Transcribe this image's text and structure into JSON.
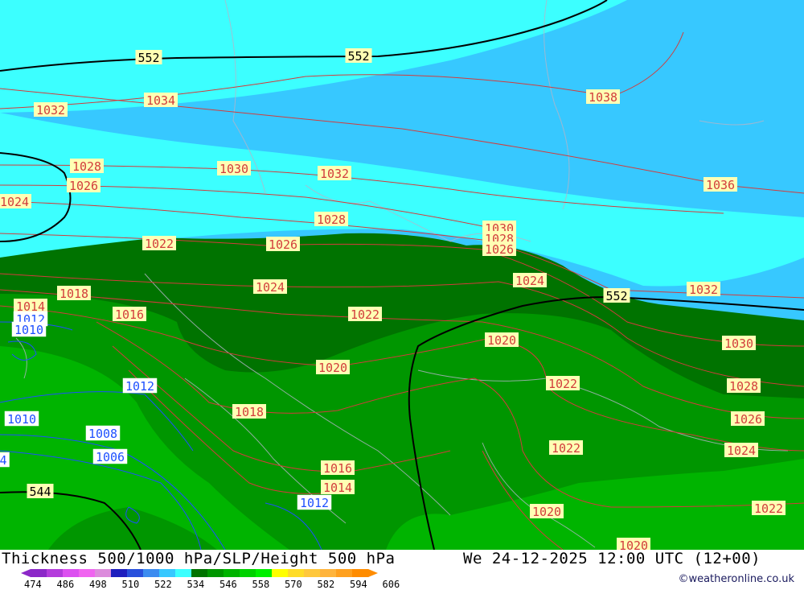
{
  "map": {
    "thickness_labels": [
      {
        "id": "t552a",
        "text": "552"
      },
      {
        "id": "t552b",
        "text": "552"
      },
      {
        "id": "t552c",
        "text": "552"
      },
      {
        "id": "t544",
        "text": "544"
      }
    ],
    "slp_labels": [
      {
        "id": "p1",
        "text": "1032"
      },
      {
        "id": "p2",
        "text": "1034"
      },
      {
        "id": "p3",
        "text": "1038"
      },
      {
        "id": "p4",
        "text": "1028"
      },
      {
        "id": "p5",
        "text": "1030"
      },
      {
        "id": "p6",
        "text": "1032"
      },
      {
        "id": "p7",
        "text": "1026"
      },
      {
        "id": "p8",
        "text": "1036"
      },
      {
        "id": "p9",
        "text": "1024"
      },
      {
        "id": "p10",
        "text": "1028"
      },
      {
        "id": "p11",
        "text": "1030"
      },
      {
        "id": "p12",
        "text": "1028"
      },
      {
        "id": "p13",
        "text": "1026"
      },
      {
        "id": "p14",
        "text": "1022"
      },
      {
        "id": "p15",
        "text": "1026"
      },
      {
        "id": "p16",
        "text": "1024"
      },
      {
        "id": "p17",
        "text": "1024"
      },
      {
        "id": "p18",
        "text": "1032"
      },
      {
        "id": "p19",
        "text": "1018"
      },
      {
        "id": "p20",
        "text": "1014"
      },
      {
        "id": "p21",
        "text": "1016"
      },
      {
        "id": "p22",
        "text": "1022"
      },
      {
        "id": "p23",
        "text": "1020"
      },
      {
        "id": "p24",
        "text": "1030"
      },
      {
        "id": "p25",
        "text": "1020"
      },
      {
        "id": "p26",
        "text": "1022"
      },
      {
        "id": "p27",
        "text": "1028"
      },
      {
        "id": "p28",
        "text": "1018"
      },
      {
        "id": "p29",
        "text": "1026"
      },
      {
        "id": "p30",
        "text": "1022"
      },
      {
        "id": "p31",
        "text": "1024"
      },
      {
        "id": "p32",
        "text": "1016"
      },
      {
        "id": "p33",
        "text": "1014"
      },
      {
        "id": "p34",
        "text": "1020"
      },
      {
        "id": "p35",
        "text": "1022"
      },
      {
        "id": "p36",
        "text": "1020"
      }
    ],
    "low_labels": [
      {
        "id": "l1",
        "text": "1012"
      },
      {
        "id": "l2",
        "text": "1010"
      },
      {
        "id": "l3",
        "text": "1012"
      },
      {
        "id": "l4",
        "text": "1010"
      },
      {
        "id": "l5",
        "text": "1008"
      },
      {
        "id": "l6",
        "text": "1006"
      },
      {
        "id": "l7",
        "text": "4"
      },
      {
        "id": "l8",
        "text": "1012"
      }
    ],
    "colors": {
      "cyan": "#3cffff",
      "sky": "#37c8ff",
      "dark_green": "#007300",
      "mid_green": "#009600",
      "light_green": "#00b400",
      "isobar": "#d23c3c",
      "low_isobar": "#1e50ff",
      "label_bg": "#ffffb4"
    }
  },
  "footer": {
    "title": "Thickness 500/1000 hPa/SLP/Height 500 hPa",
    "datetime": "We 24-12-2025 12:00 UTC (12+00)",
    "credit": "©weatheronline.co.uk",
    "scale_ticks": [
      "474",
      "486",
      "498",
      "510",
      "522",
      "534",
      "546",
      "558",
      "570",
      "582",
      "594",
      "606"
    ],
    "scale_colors": [
      "#8c28c8",
      "#b43cdc",
      "#dc50f0",
      "#f064f0",
      "#dc8cdc",
      "#1e1ebe",
      "#2850dc",
      "#3c8cf0",
      "#37c8ff",
      "#3cffff",
      "#007300",
      "#009600",
      "#00b400",
      "#00d200",
      "#00f000",
      "#ffff00",
      "#ffdc28",
      "#ffc83c",
      "#ffb43c",
      "#ffa01e",
      "#ff8c00"
    ]
  }
}
